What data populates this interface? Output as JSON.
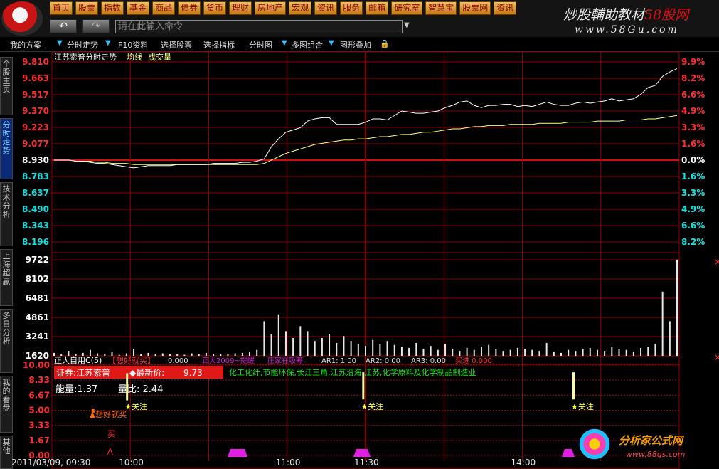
{
  "nav": [
    "首页",
    "股票",
    "指数",
    "基金",
    "商品",
    "债券",
    "货币",
    "理财",
    "房地产",
    "宏观",
    "资讯",
    "服务",
    "邮箱",
    "研究室",
    "智慧宝",
    "股票网",
    "资讯"
  ],
  "cmd_placeholder": "请在此输入命令",
  "watermark_top": {
    "a": "炒股輔助教材",
    "b": "58",
    "c": "股网",
    "url": "www.58Gu.com"
  },
  "watermark_bottom": {
    "name": "分析家公式网",
    "url": "www.88gs.com"
  },
  "toolbar": [
    "我的方案",
    "分时走势",
    "F10资料",
    "选择股票",
    "选择指标",
    "分时图",
    "多图组合",
    "图形叠加"
  ],
  "sidetabs": [
    "个股主页",
    "分时走势",
    "技术分析",
    "上海超赢",
    "多日分析",
    "我的看盘",
    "其他"
  ],
  "chart_title": [
    "江苏索普分时走势",
    "均线",
    "成交量"
  ],
  "price_ticks": [
    "9.810",
    "9.663",
    "9.517",
    "9.370",
    "9.223",
    "9.077",
    "8.930",
    "8.783",
    "8.637",
    "8.490",
    "8.343",
    "8.196"
  ],
  "pct_ticks": [
    "9.9%",
    "8.2%",
    "6.6%",
    "4.9%",
    "3.3%",
    "1.6%",
    "0.0%",
    "1.6%",
    "3.3%",
    "4.9%",
    "6.6%",
    "8.2%"
  ],
  "vol_ticks": [
    "9722",
    "8102",
    "6481",
    "4861",
    "3241",
    "1620"
  ],
  "ind_ticks": [
    "10.00",
    "8.33",
    "6.67",
    "5.00",
    "3.33",
    "1.67",
    "0.00"
  ],
  "time_labels": [
    "2011/03/09, 09:30",
    "10:00",
    "11:00",
    "11:30",
    "14:00"
  ],
  "indicator_bar": {
    "name": "正大自用C(5)",
    "tag": "【想好就买】",
    "val1": "0.000",
    "name2": "正大2009~提醒",
    "tag2": "庄家在吸筹",
    "ar1": "AR1: 1.00",
    "ar2": "AR2: 0.00",
    "ar3": "AR3: 0.00",
    "buy": "买进 0.000"
  },
  "info_box": {
    "stock": "证券:江苏索普",
    "price_label": "◆最新价:",
    "price": "9.73",
    "energy": "能量:1.37",
    "ratio": "量比: 2.44"
  },
  "sectors": "化工化纤,节能环保,长江三角,江苏沿海,江苏,化学原料及化学制品制造业",
  "annotations": {
    "want_buy": "想好就买",
    "buy": "买",
    "watch": "关注"
  },
  "colors": {
    "grid": "#8b0000",
    "price_line": "#ffffff",
    "avg_line": "#ffff80",
    "volume": "#e8e8e8",
    "up": "#ff3030",
    "down": "#18e0e0"
  },
  "chart_data": {
    "type": "line",
    "price_ref": 8.93,
    "price_range": [
      8.196,
      9.81
    ],
    "price": [
      8.93,
      8.93,
      8.93,
      8.92,
      8.92,
      8.91,
      8.9,
      8.9,
      8.89,
      8.88,
      8.87,
      8.86,
      8.87,
      8.88,
      8.88,
      8.88,
      8.88,
      8.89,
      8.89,
      8.89,
      8.89,
      8.89,
      8.9,
      8.9,
      8.9,
      8.9,
      8.91,
      8.91,
      8.92,
      8.94,
      9.05,
      9.12,
      9.18,
      9.2,
      9.22,
      9.28,
      9.3,
      9.31,
      9.31,
      9.25,
      9.25,
      9.25,
      9.25,
      9.27,
      9.3,
      9.3,
      9.29,
      9.33,
      9.37,
      9.36,
      9.35,
      9.35,
      9.36,
      9.37,
      9.4,
      9.42,
      9.45,
      9.46,
      9.42,
      9.4,
      9.42,
      9.42,
      9.43,
      9.43,
      9.41,
      9.42,
      9.41,
      9.43,
      9.45,
      9.43,
      9.42,
      9.42,
      9.44,
      9.45,
      9.44,
      9.45,
      9.46,
      9.48,
      9.46,
      9.47,
      9.48,
      9.52,
      9.58,
      9.6,
      9.68,
      9.72,
      9.75
    ],
    "avg": [
      8.93,
      8.93,
      8.93,
      8.92,
      8.92,
      8.92,
      8.91,
      8.91,
      8.9,
      8.9,
      8.9,
      8.89,
      8.89,
      8.89,
      8.89,
      8.89,
      8.89,
      8.89,
      8.89,
      8.89,
      8.89,
      8.89,
      8.89,
      8.89,
      8.89,
      8.89,
      8.89,
      8.89,
      8.89,
      8.9,
      8.93,
      8.96,
      8.99,
      9.01,
      9.03,
      9.05,
      9.07,
      9.08,
      9.09,
      9.1,
      9.11,
      9.11,
      9.12,
      9.12,
      9.13,
      9.14,
      9.14,
      9.15,
      9.16,
      9.16,
      9.17,
      9.18,
      9.18,
      9.19,
      9.2,
      9.21,
      9.21,
      9.22,
      9.23,
      9.23,
      9.24,
      9.24,
      9.24,
      9.25,
      9.25,
      9.25,
      9.25,
      9.26,
      9.26,
      9.26,
      9.26,
      9.27,
      9.27,
      9.27,
      9.27,
      9.28,
      9.28,
      9.28,
      9.28,
      9.29,
      9.29,
      9.29,
      9.3,
      9.3,
      9.31,
      9.32,
      9.33
    ],
    "volume_range": [
      0,
      9722
    ],
    "volume": [
      300,
      200,
      500,
      150,
      300,
      600,
      250,
      200,
      350,
      100,
      250,
      700,
      200,
      300,
      150,
      250,
      200,
      150,
      100,
      250,
      180,
      300,
      200,
      150,
      200,
      250,
      300,
      400,
      600,
      3500,
      2200,
      4200,
      2500,
      1800,
      3000,
      2500,
      1500,
      1800,
      2200,
      1300,
      2000,
      1500,
      1200,
      1000,
      1600,
      1200,
      1500,
      1100,
      900,
      800,
      1300,
      700,
      1000,
      600,
      1200,
      700,
      500,
      800,
      600,
      900,
      1100,
      700,
      500,
      600,
      800,
      700,
      600,
      500,
      1300,
      400,
      300,
      600,
      500,
      700,
      800,
      600,
      500,
      900,
      700,
      600,
      400,
      800,
      900,
      1200,
      6500,
      3500,
      9722
    ],
    "indicator_range": [
      0,
      10
    ],
    "want_buy_bars": [
      {
        "x_minute": 15,
        "value": 5.2
      }
    ],
    "watch_bars": [
      {
        "x_minute": 28,
        "value": 6.1
      },
      {
        "x_minute": 119,
        "value": 6.2
      },
      {
        "x_minute": 200,
        "value": 6.2
      }
    ]
  }
}
